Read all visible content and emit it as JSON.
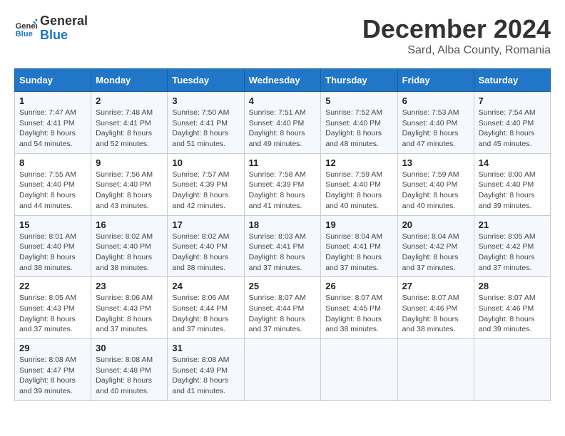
{
  "logo": {
    "line1": "General",
    "line2": "Blue"
  },
  "title": "December 2024",
  "subtitle": "Sard, Alba County, Romania",
  "days_of_week": [
    "Sunday",
    "Monday",
    "Tuesday",
    "Wednesday",
    "Thursday",
    "Friday",
    "Saturday"
  ],
  "weeks": [
    [
      {
        "day": "1",
        "sunrise": "7:47 AM",
        "sunset": "4:41 PM",
        "daylight": "8 hours and 54 minutes."
      },
      {
        "day": "2",
        "sunrise": "7:48 AM",
        "sunset": "4:41 PM",
        "daylight": "8 hours and 52 minutes."
      },
      {
        "day": "3",
        "sunrise": "7:50 AM",
        "sunset": "4:41 PM",
        "daylight": "8 hours and 51 minutes."
      },
      {
        "day": "4",
        "sunrise": "7:51 AM",
        "sunset": "4:40 PM",
        "daylight": "8 hours and 49 minutes."
      },
      {
        "day": "5",
        "sunrise": "7:52 AM",
        "sunset": "4:40 PM",
        "daylight": "8 hours and 48 minutes."
      },
      {
        "day": "6",
        "sunrise": "7:53 AM",
        "sunset": "4:40 PM",
        "daylight": "8 hours and 47 minutes."
      },
      {
        "day": "7",
        "sunrise": "7:54 AM",
        "sunset": "4:40 PM",
        "daylight": "8 hours and 45 minutes."
      }
    ],
    [
      {
        "day": "8",
        "sunrise": "7:55 AM",
        "sunset": "4:40 PM",
        "daylight": "8 hours and 44 minutes."
      },
      {
        "day": "9",
        "sunrise": "7:56 AM",
        "sunset": "4:40 PM",
        "daylight": "8 hours and 43 minutes."
      },
      {
        "day": "10",
        "sunrise": "7:57 AM",
        "sunset": "4:39 PM",
        "daylight": "8 hours and 42 minutes."
      },
      {
        "day": "11",
        "sunrise": "7:58 AM",
        "sunset": "4:39 PM",
        "daylight": "8 hours and 41 minutes."
      },
      {
        "day": "12",
        "sunrise": "7:59 AM",
        "sunset": "4:40 PM",
        "daylight": "8 hours and 40 minutes."
      },
      {
        "day": "13",
        "sunrise": "7:59 AM",
        "sunset": "4:40 PM",
        "daylight": "8 hours and 40 minutes."
      },
      {
        "day": "14",
        "sunrise": "8:00 AM",
        "sunset": "4:40 PM",
        "daylight": "8 hours and 39 minutes."
      }
    ],
    [
      {
        "day": "15",
        "sunrise": "8:01 AM",
        "sunset": "4:40 PM",
        "daylight": "8 hours and 38 minutes."
      },
      {
        "day": "16",
        "sunrise": "8:02 AM",
        "sunset": "4:40 PM",
        "daylight": "8 hours and 38 minutes."
      },
      {
        "day": "17",
        "sunrise": "8:02 AM",
        "sunset": "4:40 PM",
        "daylight": "8 hours and 38 minutes."
      },
      {
        "day": "18",
        "sunrise": "8:03 AM",
        "sunset": "4:41 PM",
        "daylight": "8 hours and 37 minutes."
      },
      {
        "day": "19",
        "sunrise": "8:04 AM",
        "sunset": "4:41 PM",
        "daylight": "8 hours and 37 minutes."
      },
      {
        "day": "20",
        "sunrise": "8:04 AM",
        "sunset": "4:42 PM",
        "daylight": "8 hours and 37 minutes."
      },
      {
        "day": "21",
        "sunrise": "8:05 AM",
        "sunset": "4:42 PM",
        "daylight": "8 hours and 37 minutes."
      }
    ],
    [
      {
        "day": "22",
        "sunrise": "8:05 AM",
        "sunset": "4:43 PM",
        "daylight": "8 hours and 37 minutes."
      },
      {
        "day": "23",
        "sunrise": "8:06 AM",
        "sunset": "4:43 PM",
        "daylight": "8 hours and 37 minutes."
      },
      {
        "day": "24",
        "sunrise": "8:06 AM",
        "sunset": "4:44 PM",
        "daylight": "8 hours and 37 minutes."
      },
      {
        "day": "25",
        "sunrise": "8:07 AM",
        "sunset": "4:44 PM",
        "daylight": "8 hours and 37 minutes."
      },
      {
        "day": "26",
        "sunrise": "8:07 AM",
        "sunset": "4:45 PM",
        "daylight": "8 hours and 38 minutes."
      },
      {
        "day": "27",
        "sunrise": "8:07 AM",
        "sunset": "4:46 PM",
        "daylight": "8 hours and 38 minutes."
      },
      {
        "day": "28",
        "sunrise": "8:07 AM",
        "sunset": "4:46 PM",
        "daylight": "8 hours and 39 minutes."
      }
    ],
    [
      {
        "day": "29",
        "sunrise": "8:08 AM",
        "sunset": "4:47 PM",
        "daylight": "8 hours and 39 minutes."
      },
      {
        "day": "30",
        "sunrise": "8:08 AM",
        "sunset": "4:48 PM",
        "daylight": "8 hours and 40 minutes."
      },
      {
        "day": "31",
        "sunrise": "8:08 AM",
        "sunset": "4:49 PM",
        "daylight": "8 hours and 41 minutes."
      },
      null,
      null,
      null,
      null
    ]
  ]
}
